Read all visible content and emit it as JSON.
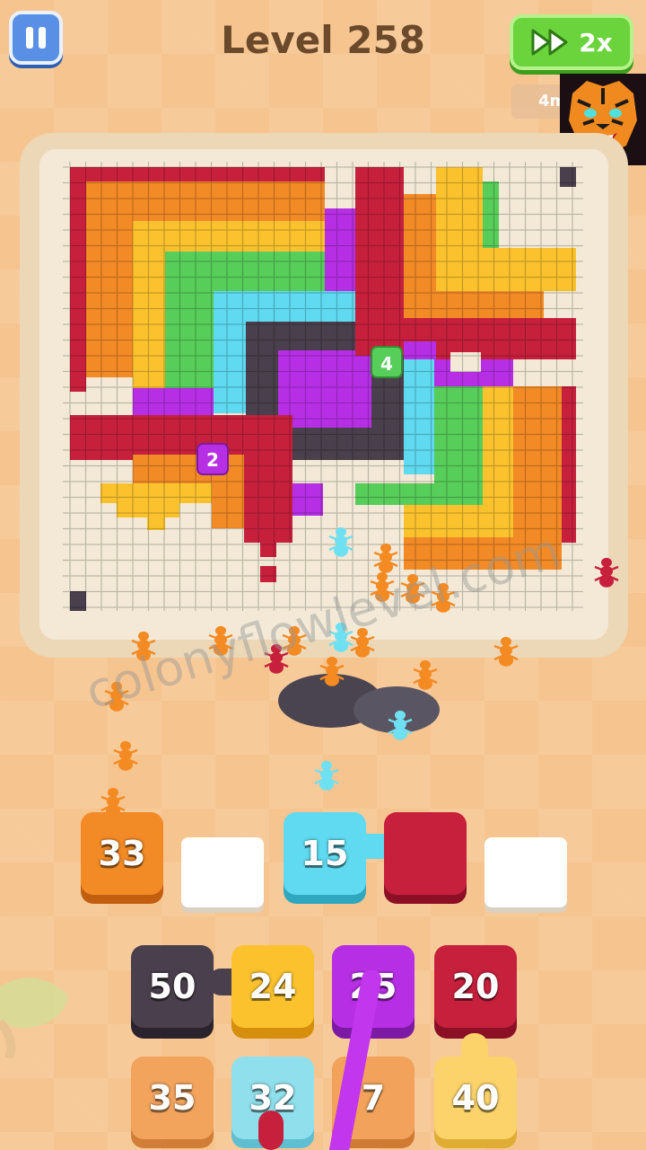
{
  "header": {
    "level_title": "Level 258",
    "speed_label": "2x",
    "timer_text": "4m"
  },
  "board_colors": {
    "crimson": "#c7203c",
    "orange": "#f28a26",
    "yellow": "#fbc22e",
    "green": "#57cd5a",
    "cyan": "#5fdaf0",
    "purple": "#b72fe5",
    "dark": "#4a3f4c",
    "ant_orange": "#f48a22",
    "ant_cyan": "#6fe0f2"
  },
  "board_markers": [
    {
      "label": "4",
      "color": "#57cd5a"
    },
    {
      "label": "2",
      "color": "#b72fe5"
    }
  ],
  "watermark": "colonyflowlevel.com",
  "queue_slots": [
    {
      "number": "33",
      "color": "#f28a26",
      "empty": false
    },
    {
      "number": "",
      "color": "#ffffff",
      "empty": true
    },
    {
      "number": "15",
      "color": "#5fdaf0",
      "empty": false
    },
    {
      "number": "",
      "color": "#c7203c",
      "empty": false
    },
    {
      "number": "",
      "color": "#ffffff",
      "empty": true
    }
  ],
  "tray_row1": [
    {
      "number": "50",
      "color": "#4a3f4c"
    },
    {
      "number": "24",
      "color": "#fbc22e"
    },
    {
      "number": "25",
      "color": "#b72fe5"
    },
    {
      "number": "20",
      "color": "#c7203c"
    }
  ],
  "tray_row2": [
    {
      "number": "35",
      "color": "#f2a25a"
    },
    {
      "number": "32",
      "color": "#8fe0ec"
    },
    {
      "number": "7",
      "color": "#f2a25a"
    },
    {
      "number": "40",
      "color": "#fbd36a"
    }
  ]
}
